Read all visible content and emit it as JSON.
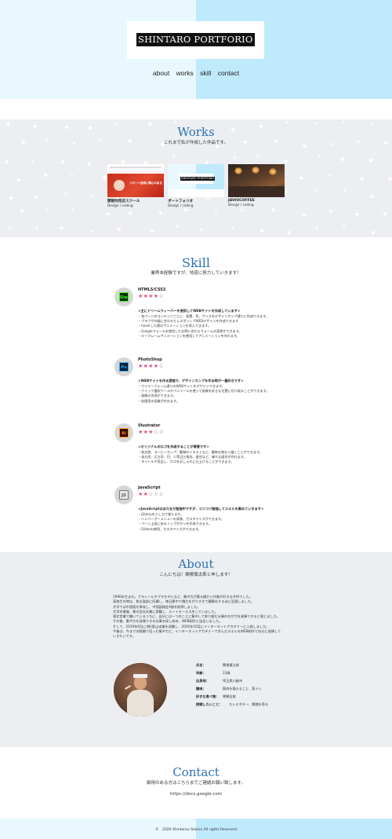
{
  "header": {
    "logo": "SHINTARO PORTFORIO",
    "nav": [
      "about",
      "works",
      "skill",
      "contact"
    ]
  },
  "works": {
    "title": "Works",
    "subtitle": "これまで私が作成した作品です。",
    "items": [
      {
        "name": "開智阿見店スクール",
        "role": "Design / coding",
        "thumb_title": "ドローン活用に関心のある"
      },
      {
        "name": "ポートフォリオ",
        "role": "Design / coding",
        "thumb_title": "SHINTARO PORTFORIO"
      },
      {
        "name": "JAVIOCOFFEE",
        "role": "Design / coding"
      }
    ]
  },
  "skill": {
    "title": "Skill",
    "subtitle": "業界未経験ですが、地道に努力していきます！",
    "items": [
      {
        "icon_label": "Dw",
        "icon_name": "dreamweaver-icon",
        "name": "HTML5/CSS3",
        "stars": 4,
        "heading": "<主にドリームウィーバーを使用してWEBサイトを作成しています>",
        "points": [
          "・各ページのコンテンツごとに、配置、色、サイズをデザインカンプ通りに作成できます。",
          "・ブラウザの幅に合わせたレスポンシブWEBデザインを作成できます",
          "・hoverした際のアニメーションを導入できます。",
          "・Googleフォームを使用したお問い合わせフォームの実装ができます。",
          "・キーフレームアニメーションを使用してアニメーションを作れます。"
        ]
      },
      {
        "icon_label": "Ps",
        "icon_name": "photoshop-icon",
        "name": "PhotoShop",
        "stars": 4,
        "heading": "<WEBサイトを作る過程で、デザインカンプを作る時が一番好きです>",
        "points": [
          "・ワイヤーフレーム通りのWEBサイトをデザインできます。",
          "・クイック選択ツールやペンツールを使って画像を好きな位置に切り取ることができます。",
          "・画像の合成ができます。",
          "・処理型の画像が作れます。"
        ]
      },
      {
        "icon_label": "Ai",
        "icon_name": "illustrator-icon",
        "name": "Illustrator",
        "stars": 3,
        "heading": "<オリジナルのロゴを作成することが得意です>",
        "points": [
          "・和文鉄、コーヒーカップ、動物のイラストなど、簡単な物なら描くことができます。",
          "・長方形、正方形、円、二等辺三角形、星形など、様々な図形が作れます。",
          "・タイトルや見出し、ロゴをおしゃれに仕上げることができます。"
        ]
      },
      {
        "icon_label": "JS",
        "icon_name": "javascript-icon",
        "name": "JavaScript",
        "stars": 2,
        "heading": "<JavaScriptはまだまだ勉強中ですが、コツコツ勉強してスキルを高めていきます>",
        "points": [
          "・jQueryを少しだけ使えます。",
          "・ハンバーガーメニューの実装、カスタマイズができます。",
          "・ページ上部に戻るトップボタンを作成できます。",
          "・Sliderの使用、カスタマイズができます。"
        ]
      }
    ]
  },
  "about": {
    "title": "About",
    "subtitle": "こんにちは！関根慎太郎と申します！",
    "paragraphs": [
      "1996年生まれ。プラレールやプラモデルなど、集中力が要る細かい作業が好きな子供でした。",
      "高校生の時は、和太鼓部に所属し、毎日夢中で稽古をがりすぎて腱鞘炎するほど没頭しました。",
      "大学では中国語を専攻し、中国語検定4級を取得しました。",
      "大学卒業後、株式会社米兼に就職し、ルートセールスをしていました。",
      "東北営業で働いているうちに、自分にはーつのことに集中して取り組む仕事の方が力を発揮できると感じました。その後、集中力を発揮できる仕事を探し始め、WEB制作と出会いました。",
      "そして、2019年6月に(株)東山米兼を退職し、2020年10月にインターネットアカデミーに入校しました。",
      "今後は、今までの経験で培った集中力と、インターネットアカデミーで学んだスキルをWEB制作で存分に発揮していきたいです。"
    ],
    "profile": [
      {
        "k": "氏名：",
        "v": "関根慎太郎"
      },
      {
        "k": "年齢：",
        "v": "23歳"
      },
      {
        "k": "出身地：",
        "v": "埼玉県川越市"
      },
      {
        "k": "趣味：",
        "v": "筋肉を鍛えること、筋トレ"
      },
      {
        "k": "好きな食べ物：",
        "v": "寒鰤全般"
      },
      {
        "k": "挑戦したいこと：",
        "v": "エレキギター、舞踏を祭る"
      }
    ]
  },
  "contact": {
    "title": "Contact",
    "subtitle": "御用のある方はこちらまでご連絡お願い致します。",
    "link": "https://docs.google.com"
  },
  "footer": {
    "text": "©　2020 Shintarou Sekine All rights Reserved"
  },
  "colors": {
    "accent": "#2b73b6",
    "stars": "#e14e8b",
    "header_left": "#e9f8fe",
    "header_right": "#bfeafb",
    "section_gray": "#eceef1"
  }
}
